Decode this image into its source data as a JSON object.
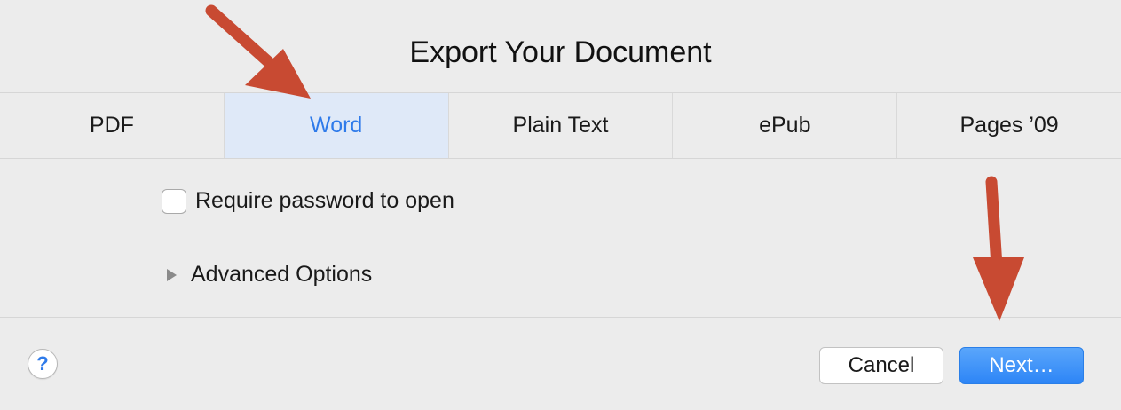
{
  "dialog": {
    "title": "Export Your Document",
    "tabs": [
      {
        "label": "PDF",
        "selected": false
      },
      {
        "label": "Word",
        "selected": true
      },
      {
        "label": "Plain Text",
        "selected": false
      },
      {
        "label": "ePub",
        "selected": false
      },
      {
        "label": "Pages ’09",
        "selected": false
      }
    ],
    "options": {
      "require_password_label": "Require password to open",
      "require_password_checked": false,
      "advanced_options_label": "Advanced Options"
    },
    "footer": {
      "help_glyph": "?",
      "cancel_label": "Cancel",
      "next_label": "Next…"
    }
  },
  "colors": {
    "accent": "#2f7bea",
    "selected_tab_bg": "#dfe9f8",
    "annotation_arrow": "#c84a32"
  },
  "icons": [
    "help-icon",
    "disclosure-triangle-icon",
    "annotation-arrow"
  ]
}
